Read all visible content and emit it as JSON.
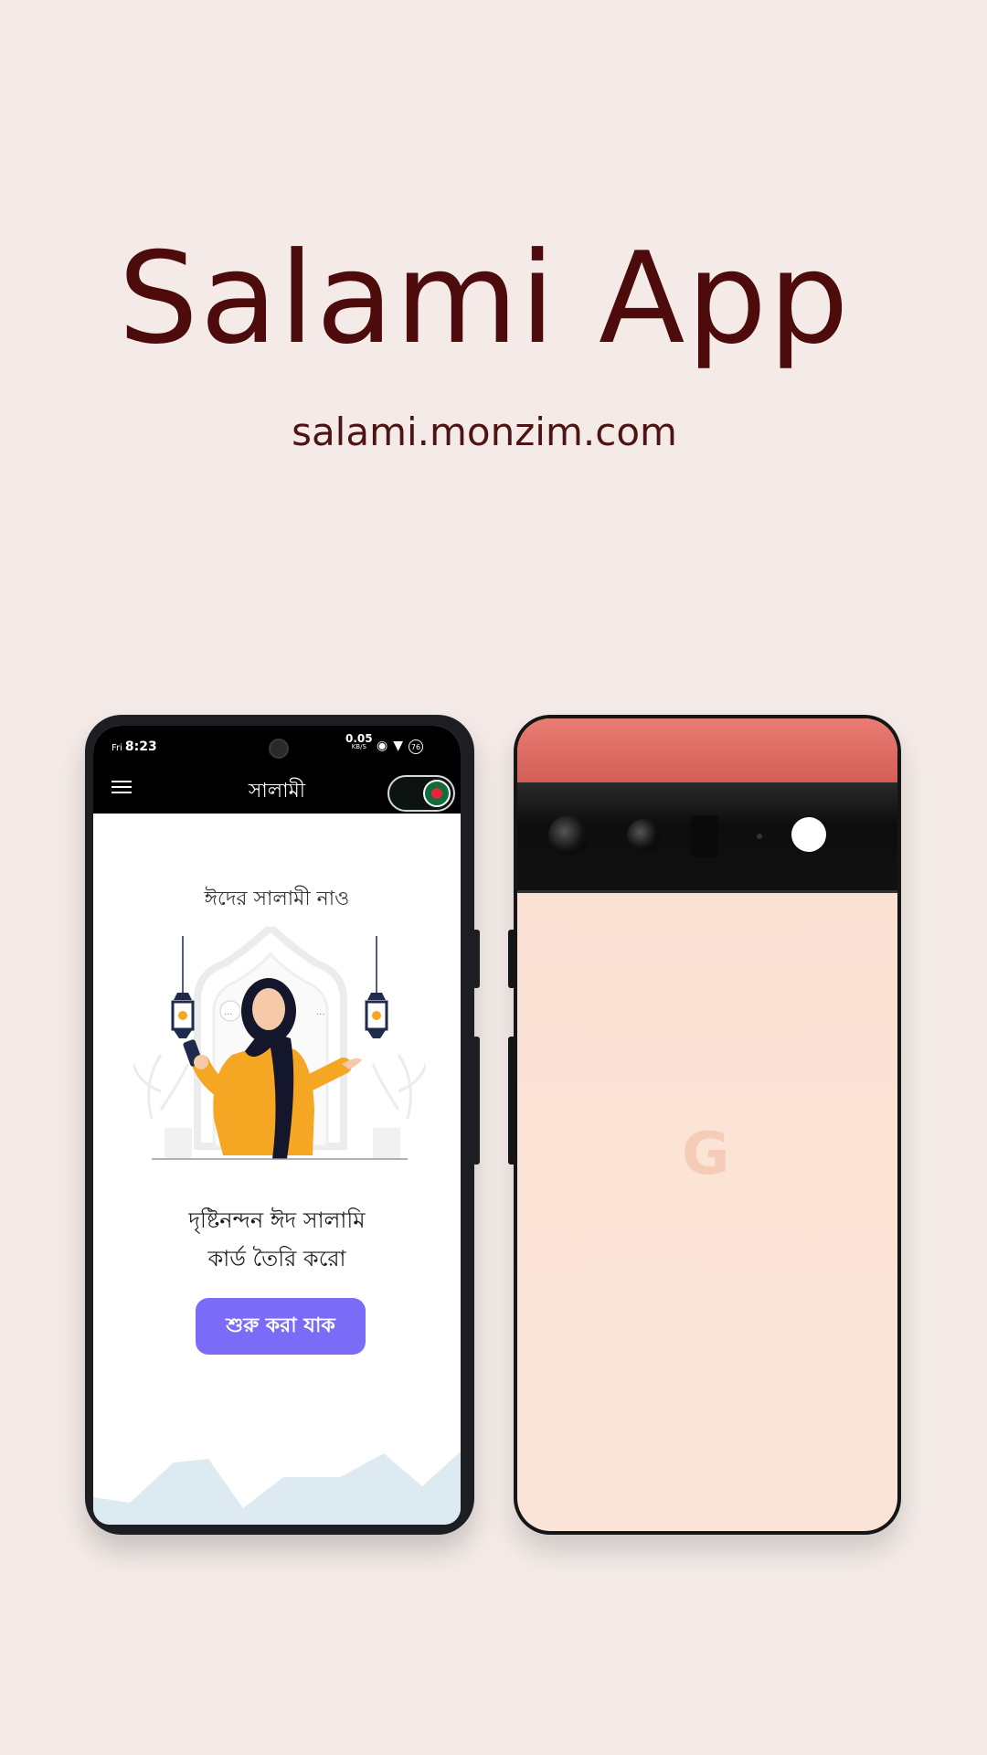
{
  "header": {
    "title": "Salami App",
    "subtitle": "salami.monzim.com"
  },
  "phone": {
    "status": {
      "day": "Fri",
      "time": "8:23",
      "net_speed": "0.05",
      "net_unit": "KB/S",
      "battery": "76"
    },
    "appbar": {
      "title": "সালামী",
      "menu_icon": "hamburger-icon",
      "toggle": "on"
    },
    "screen": {
      "heading": "ঈদের সালামী নাও",
      "tagline_line1": "দৃষ্টিনন্দন ঈদ সালামি",
      "tagline_line2": "কার্ড তৈরি করো",
      "cta_label": "শুরু করা যাক"
    }
  },
  "back_phone": {
    "logo_text": "G"
  },
  "colors": {
    "background": "#f4ebe8",
    "title": "#4e0b0b",
    "cta": "#7a6cf7",
    "appbar": "#000000",
    "back_top": "#d35e58",
    "back_body": "#fae2d6"
  }
}
